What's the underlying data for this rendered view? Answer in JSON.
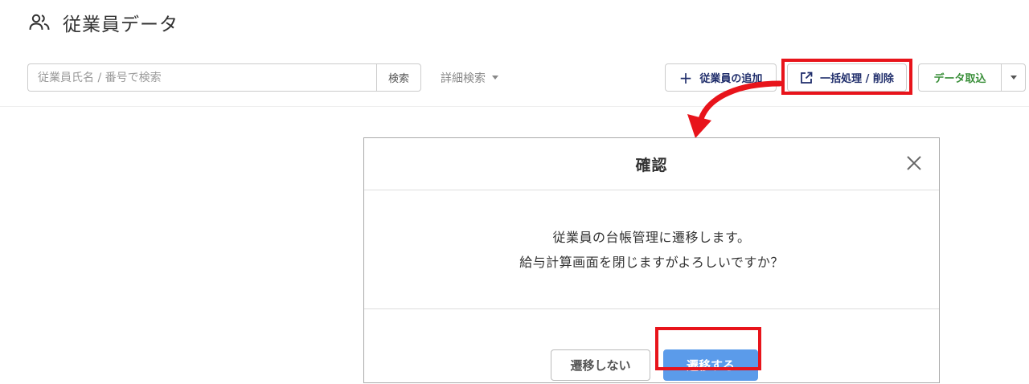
{
  "header": {
    "title": "従業員データ",
    "icon": "people-icon"
  },
  "toolbar": {
    "search_placeholder": "従業員氏名 / 番号で検索",
    "search_button": "検索",
    "advanced_search": "詳細検索",
    "add_employee_label": "従業員の追加",
    "bulk_process_label": "一括処理 / 削除",
    "import_label": "データ取込"
  },
  "modal": {
    "title": "確認",
    "message_line1": "従業員の台帳管理に遷移します。",
    "message_line2": "給与計算画面を閉じますがよろしいですか？",
    "cancel_label": "遷移しない",
    "confirm_label": "遷移する"
  },
  "colors": {
    "highlight": "#e8141b",
    "primary_button": "#5b9bea",
    "navy_text": "#1f2d6b",
    "green_text": "#3a8f3a"
  }
}
